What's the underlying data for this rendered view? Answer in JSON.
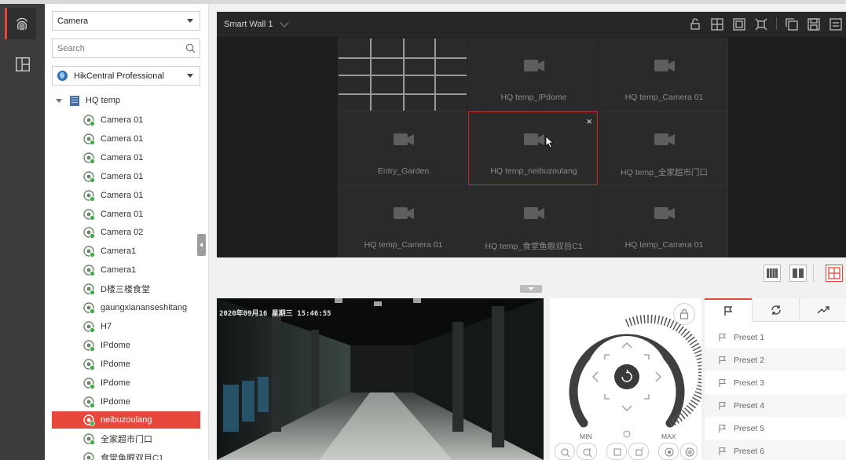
{
  "rail": {
    "items": [
      {
        "icon": "fingerprint-icon",
        "active": true
      },
      {
        "icon": "layout-panel-icon",
        "active": false
      }
    ]
  },
  "resource_panel": {
    "type_select": "Camera",
    "search_placeholder": "Search",
    "site_select": "HikCentral Professional",
    "tree_root": "HQ temp",
    "items": [
      "Camera 01",
      "Camera 01",
      "Camera 01",
      "Camera 01",
      "Camera 01",
      "Camera 01",
      "Camera 02",
      "Camera1",
      "Camera1",
      "D楼三楼食堂",
      "gaungxiananseshitang",
      "H7",
      "IPdome",
      "IPdome",
      "IPdome",
      "IPdome",
      "neibuzoulang",
      "全家超市门口",
      "食堂鱼眼双目C1"
    ],
    "selected_index": 16
  },
  "smart_wall": {
    "title": "Smart Wall 1",
    "toolbar_icons": [
      "unlock-icon",
      "window-division-icon",
      "roaming-window-icon",
      "scene-icon",
      "copy-icon",
      "save-icon",
      "settings-icon"
    ],
    "tiles": [
      {
        "label": "",
        "kind": "grid"
      },
      {
        "label": "HQ temp_IPdome",
        "kind": "camera"
      },
      {
        "label": "HQ temp_Camera 01",
        "kind": "camera"
      },
      {
        "label": "Entry_Garden",
        "kind": "camera"
      },
      {
        "label": "HQ temp_neibuzoulang",
        "kind": "camera",
        "active": true,
        "close": "×"
      },
      {
        "label": "HQ temp_全家超市门口",
        "kind": "camera"
      },
      {
        "label": "HQ temp_Camera 01",
        "kind": "camera"
      },
      {
        "label": "HQ temp_食堂鱼眼双目C1",
        "kind": "camera"
      },
      {
        "label": "HQ temp_Camera 01",
        "kind": "camera"
      }
    ]
  },
  "preview": {
    "osd_text": "2020年09月16   星期三  15:46:55"
  },
  "ptz": {
    "min_label": "MIN",
    "max_label": "MAX"
  },
  "presets": {
    "tabs": [
      "preset-flag-icon",
      "patrol-icon",
      "pattern-icon"
    ],
    "active_tab": 0,
    "items": [
      "Preset 1",
      "Preset 2",
      "Preset 3",
      "Preset 4",
      "Preset 5",
      "Preset 6"
    ]
  },
  "colors": {
    "accent": "#e8473c",
    "wall_bg": "#1e1e1e",
    "tile_bg": "#2a2a2a"
  }
}
